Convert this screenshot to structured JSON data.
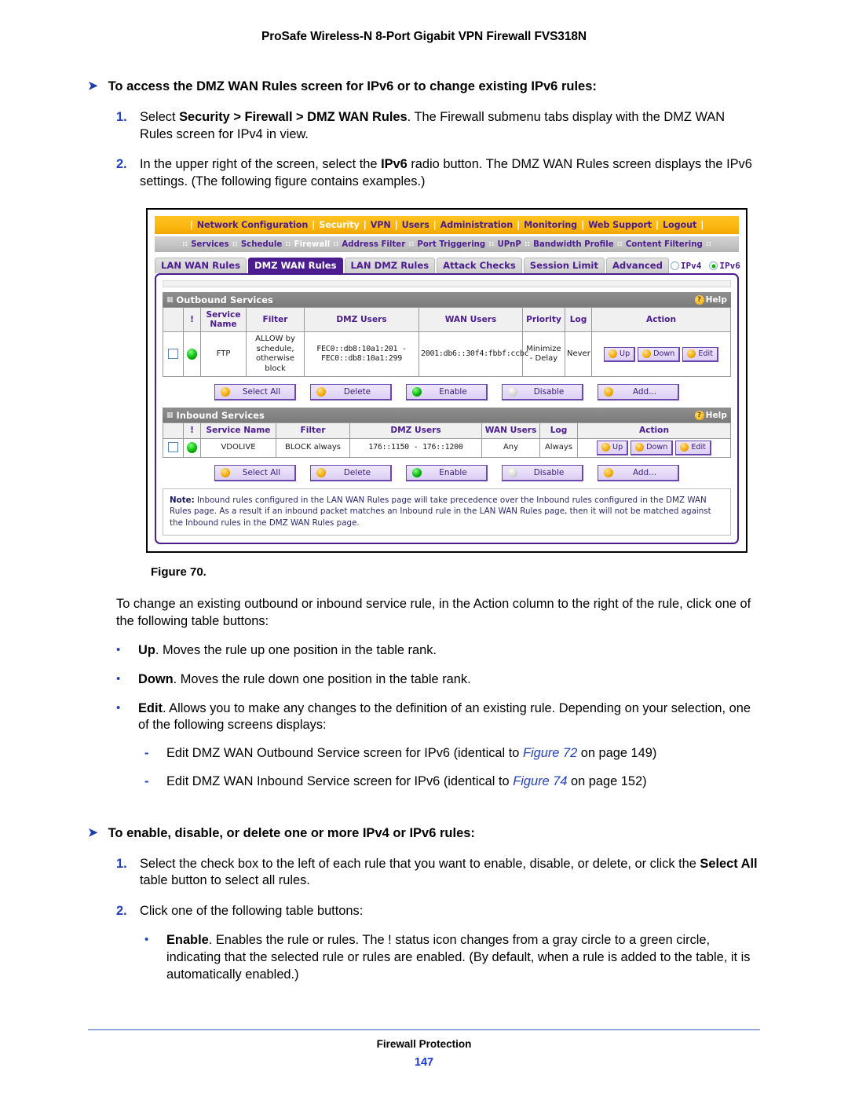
{
  "header": {
    "title": "ProSafe Wireless-N 8-Port Gigabit VPN Firewall FVS318N"
  },
  "footer": {
    "section": "Firewall Protection",
    "page_number": "147"
  },
  "procedure1": {
    "heading": "To access the DMZ WAN Rules screen for IPv6 or to change existing IPv6 rules:",
    "steps": [
      {
        "num": "1.",
        "pre": "Select ",
        "bold": "Security > Firewall > DMZ WAN Rules",
        "post": ". The Firewall submenu tabs display with the DMZ WAN Rules screen for IPv4 in view."
      },
      {
        "num": "2.",
        "pre": "In the upper right of the screen, select the ",
        "bold": "IPv6",
        "post": " radio button. The DMZ WAN Rules screen displays the IPv6 settings. (The following figure contains examples.)"
      }
    ]
  },
  "figure": {
    "caption": "Figure 70.",
    "nav_main": {
      "items": [
        {
          "label": "Network Configuration",
          "selected": false
        },
        {
          "label": "Security",
          "selected": true
        },
        {
          "label": "VPN",
          "selected": false
        },
        {
          "label": "Users",
          "selected": false
        },
        {
          "label": "Administration",
          "selected": false
        },
        {
          "label": "Monitoring",
          "selected": false
        },
        {
          "label": "Web Support",
          "selected": false
        },
        {
          "label": "Logout",
          "selected": false
        }
      ]
    },
    "nav_sub": {
      "items": [
        {
          "label": "Services",
          "selected": false
        },
        {
          "label": "Schedule",
          "selected": false
        },
        {
          "label": "Firewall",
          "selected": true
        },
        {
          "label": "Address Filter",
          "selected": false
        },
        {
          "label": "Port Triggering",
          "selected": false
        },
        {
          "label": "UPnP",
          "selected": false
        },
        {
          "label": "Bandwidth Profile",
          "selected": false
        },
        {
          "label": "Content Filtering",
          "selected": false
        }
      ]
    },
    "tabs": [
      {
        "label": "LAN WAN Rules",
        "active": false
      },
      {
        "label": "DMZ WAN Rules",
        "active": true
      },
      {
        "label": "LAN DMZ Rules",
        "active": false
      },
      {
        "label": "Attack Checks",
        "active": false
      },
      {
        "label": "Session Limit",
        "active": false
      },
      {
        "label": "Advanced",
        "active": false
      }
    ],
    "ip_version": {
      "ipv4_label": "IPv4",
      "ipv6_label": "IPv6",
      "selected": "IPv6"
    },
    "outbound": {
      "title": "Outbound Services",
      "help_label": "Help",
      "columns": [
        "",
        "!",
        "Service Name",
        "Filter",
        "DMZ Users",
        "WAN Users",
        "Priority",
        "Log",
        "Action"
      ],
      "rows": [
        {
          "checked": false,
          "status": "enabled",
          "service_name": "FTP",
          "filter": "ALLOW by schedule, otherwise block",
          "dmz_users": "FEC0::db8:10a1:201 - FEC0::db8:10a1:299",
          "wan_users": "2001:db6::30f4:fbbf:ccbc",
          "priority": "Minimize - Delay",
          "log": "Never",
          "actions": [
            "Up",
            "Down",
            "Edit"
          ]
        }
      ],
      "buttons": [
        {
          "label": "Select All",
          "icon": "orange-check-icon"
        },
        {
          "label": "Delete",
          "icon": "orange-x-icon"
        },
        {
          "label": "Enable",
          "icon": "green-circle-icon"
        },
        {
          "label": "Disable",
          "icon": "gray-circle-icon"
        },
        {
          "label": "Add...",
          "icon": "orange-plus-icon"
        }
      ]
    },
    "inbound": {
      "title": "Inbound Services",
      "help_label": "Help",
      "columns": [
        "",
        "!",
        "Service Name",
        "Filter",
        "DMZ Users",
        "WAN Users",
        "Log",
        "Action"
      ],
      "rows": [
        {
          "checked": false,
          "status": "enabled",
          "service_name": "VDOLIVE",
          "filter": "BLOCK always",
          "dmz_users": "176::1150 - 176::1200",
          "wan_users": "Any",
          "log": "Always",
          "actions": [
            "Up",
            "Down",
            "Edit"
          ]
        }
      ],
      "buttons": [
        {
          "label": "Select All",
          "icon": "orange-check-icon"
        },
        {
          "label": "Delete",
          "icon": "orange-x-icon"
        },
        {
          "label": "Enable",
          "icon": "green-circle-icon"
        },
        {
          "label": "Disable",
          "icon": "gray-circle-icon"
        },
        {
          "label": "Add...",
          "icon": "orange-plus-icon"
        }
      ]
    },
    "note": {
      "label": "Note:",
      "text": " Inbound rules configured in the LAN WAN Rules page will take precedence over the Inbound rules configured in the DMZ WAN Rules page. As a result if an inbound packet matches an Inbound rule in the LAN WAN Rules page, then it will not be matched against the Inbound rules in the DMZ WAN Rules page."
    }
  },
  "after_figure": {
    "intro": "To change an existing outbound or inbound service rule, in the Action column to the right of the rule, click one of the following table buttons:",
    "bullets": [
      {
        "bold": "Up",
        "rest": ". Moves the rule up one position in the table rank."
      },
      {
        "bold": "Down",
        "rest": ". Moves the rule down one position in the table rank."
      },
      {
        "bold": "Edit",
        "rest": ". Allows you to make any changes to the definition of an existing rule. Depending on your selection, one of the following screens displays:"
      }
    ],
    "subitems": [
      {
        "pre": "Edit DMZ WAN Outbound Service screen for IPv6 (identical to ",
        "ref": "Figure 72",
        "post": " on page 149)"
      },
      {
        "pre": "Edit DMZ WAN Inbound Service screen for IPv6 (identical to ",
        "ref": "Figure 74",
        "post": " on page 152)"
      }
    ]
  },
  "procedure2": {
    "heading": "To enable, disable, or delete one or more IPv4 or IPv6 rules:",
    "steps": [
      {
        "num": "1.",
        "pre": "Select the check box to the left of each rule that you want to enable, disable, or delete, or click the ",
        "bold": "Select All",
        "post": " table button to select all rules."
      },
      {
        "num": "2.",
        "pre": "Click one of the following table buttons:",
        "bold": "",
        "post": ""
      }
    ],
    "sub_bullets": [
      {
        "bold": "Enable",
        "rest": ". Enables the rule or rules. The ! status icon changes from a gray circle to a green circle, indicating that the selected rule or rules are enabled. (By default, when a rule is added to the table, it is automatically enabled.)"
      }
    ]
  },
  "colors": {
    "nav_orange": "#fcb711",
    "purple": "#4b1d8f",
    "link_blue": "#2340b8",
    "status_green": "#00b200",
    "section_gray": "#7a7a7a"
  }
}
